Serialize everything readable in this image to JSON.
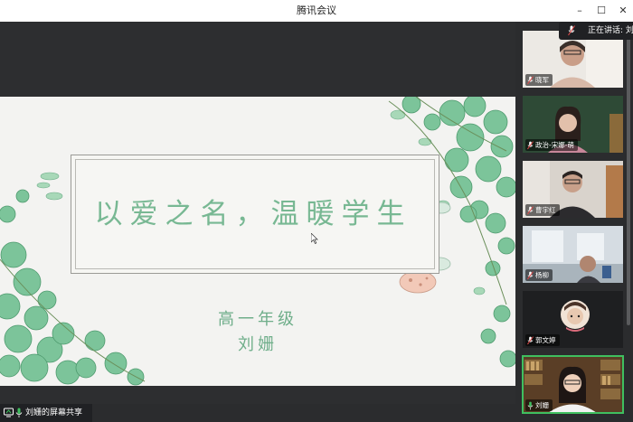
{
  "window": {
    "title": "腾讯会议",
    "minimize": "–",
    "maximize": "☐",
    "close": "✕"
  },
  "speaking": {
    "label": "正在讲话: 刘"
  },
  "slide": {
    "title": "以爱之名，温暖学生",
    "grade": "高一年级",
    "teacher": "刘姗"
  },
  "participants": [
    {
      "name": "晓军",
      "muted": true
    },
    {
      "name": "政治-宋娜-萌",
      "muted": true
    },
    {
      "name": "曹宇红",
      "muted": true
    },
    {
      "name": "杨柳",
      "muted": true
    },
    {
      "name": "郭文婷",
      "muted": true
    },
    {
      "name": "刘姗",
      "muted": false
    }
  ],
  "share": {
    "label": "刘姗的屏幕共享"
  },
  "colors": {
    "accent_green": "#3fbf5f",
    "title_green": "#78b893",
    "mute_red": "#e04a4a"
  }
}
